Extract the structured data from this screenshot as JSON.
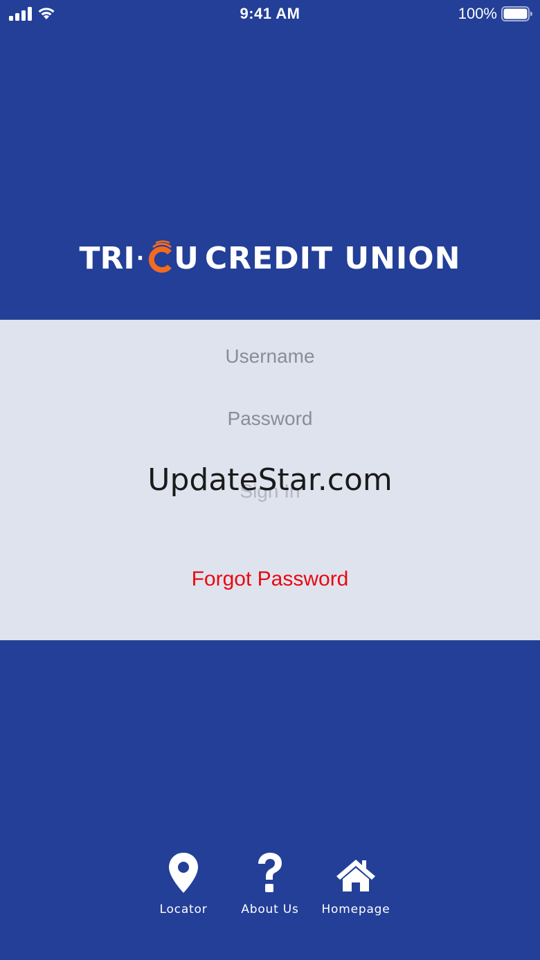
{
  "status_bar": {
    "time": "9:41 AM",
    "battery_percent": "100%",
    "icons": [
      "signal-icon",
      "wifi-icon",
      "battery-icon"
    ]
  },
  "logo": {
    "tri": "TRI",
    "dot": "·",
    "c_letter": "C",
    "u_letter": "U",
    "rest": "CREDIT UNION",
    "accent_color": "#f26b21"
  },
  "login": {
    "username_placeholder": "Username",
    "password_placeholder": "Password",
    "signin_label": "Sign In",
    "forgot_label": "Forgot Password"
  },
  "watermark": "UpdateStar.com",
  "nav": {
    "items": [
      {
        "label": "Locator",
        "icon": "map-pin-icon"
      },
      {
        "label": "About Us",
        "icon": "question-mark-icon"
      },
      {
        "label": "Homepage",
        "icon": "home-icon"
      }
    ]
  },
  "colors": {
    "background": "#233f98",
    "panel": "#dfe3ee",
    "forgot": "#e8090f"
  }
}
